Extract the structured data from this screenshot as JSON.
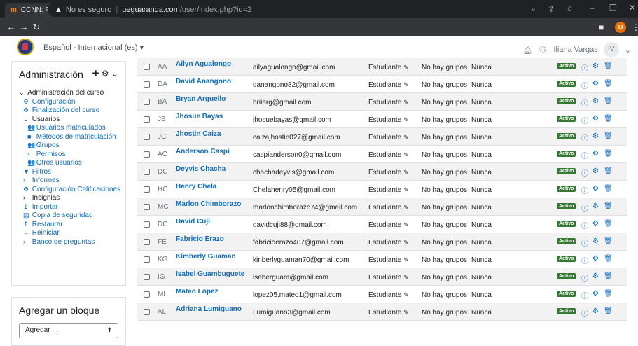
{
  "browser": {
    "tab_title": "CCNN: Participantes",
    "tab_icon": "moodle-icon",
    "security": "No es seguro",
    "url_host": "ueguaranda.com",
    "url_path": "/user/index.php?id=2",
    "profile_initial": "U"
  },
  "navbar": {
    "language": "Español - Internacional (es) ▾",
    "user_name": "Iliana Vargas",
    "user_initials": "IV"
  },
  "admin_block": {
    "title": "Administración",
    "items": [
      {
        "label": "Administración del curso",
        "prefix": "⌄",
        "style": "plain",
        "indent": 0
      },
      {
        "label": "Configuración",
        "prefix": "⚙",
        "style": "link",
        "indent": 1
      },
      {
        "label": "Finalización del curso",
        "prefix": "⚙",
        "style": "link",
        "indent": 1
      },
      {
        "label": "Usuarios",
        "prefix": "⌄",
        "style": "plain",
        "indent": 1
      },
      {
        "label": "Usuarios matriculados",
        "prefix": "👥",
        "style": "link",
        "indent": 2
      },
      {
        "label": "Métodos de matriculación",
        "prefix": "■",
        "style": "link",
        "indent": 2
      },
      {
        "label": "Grupos",
        "prefix": "👥",
        "style": "link",
        "indent": 2
      },
      {
        "label": "Permisos",
        "prefix": "›",
        "style": "link",
        "indent": 2
      },
      {
        "label": "Otros usuarios",
        "prefix": "👥",
        "style": "link",
        "indent": 2
      },
      {
        "label": "Filtros",
        "prefix": "▼",
        "style": "link",
        "indent": 1
      },
      {
        "label": "Informes",
        "prefix": "›",
        "style": "link",
        "indent": 1
      },
      {
        "label": "Configuración Calificaciones",
        "prefix": "⚙",
        "style": "link",
        "indent": 1
      },
      {
        "label": "Insignias",
        "prefix": "›",
        "style": "plain",
        "indent": 1
      },
      {
        "label": "Importar",
        "prefix": "↥",
        "style": "link",
        "indent": 1
      },
      {
        "label": "Copia de seguridad",
        "prefix": "▤",
        "style": "link",
        "indent": 1
      },
      {
        "label": "Restaurar",
        "prefix": "↥",
        "style": "link",
        "indent": 1
      },
      {
        "label": "Reiniciar",
        "prefix": "←",
        "style": "link",
        "indent": 1
      },
      {
        "label": "Banco de preguntas",
        "prefix": "›",
        "style": "link",
        "indent": 1
      }
    ]
  },
  "add_block": {
    "title": "Agregar un bloque",
    "select_value": "Agregar ..."
  },
  "participants": {
    "role": "Estudiante",
    "groups": "No hay grupos",
    "last_access": "Nunca",
    "status": "Activo",
    "rows": [
      {
        "initials": "AA",
        "name": "Ailyn Agualongo",
        "email": "ailyagualongo@gmail.com"
      },
      {
        "initials": "DA",
        "name": "David Anangono",
        "email": "danangono82@gmail.com"
      },
      {
        "initials": "BA",
        "name": "Bryan Arguello",
        "email": "briiarg@gmail.com"
      },
      {
        "initials": "JB",
        "name": "Jhosue Bayas",
        "email": "jhosuebayas@gmail.com"
      },
      {
        "initials": "JC",
        "name": "Jhostin Caiza",
        "email": "caizajhostin027@gmail.com"
      },
      {
        "initials": "AC",
        "name": "Anderson Caspi",
        "email": "caspianderson0@gmail.com"
      },
      {
        "initials": "DC",
        "name": "Deyvis Chacha",
        "email": "chachadeyvis@gmail.com"
      },
      {
        "initials": "HC",
        "name": "Henry Chela",
        "email": "Chelahenry05@gmail.com"
      },
      {
        "initials": "MC",
        "name": "Marlon Chimborazo",
        "email": "marlonchimborazo74@gmail.com"
      },
      {
        "initials": "DC",
        "name": "David Cuji",
        "email": "davidcuji88@gmail.com"
      },
      {
        "initials": "FE",
        "name": "Fabricio Erazo",
        "email": "fabricioerazo407@gmail.com"
      },
      {
        "initials": "KG",
        "name": "Kimberly Guaman",
        "email": "kinberlyguaman70@gmail.com"
      },
      {
        "initials": "IG",
        "name": "Isabel Guambuguete",
        "email": "isaberguam@gmail.com"
      },
      {
        "initials": "ML",
        "name": "Mateo Lopez",
        "email": "lopez05.mateo1@gmail.com"
      },
      {
        "initials": "AL",
        "name": "Adriana Lumiguano",
        "email": "Lumiguano3@gmail.com"
      }
    ]
  }
}
